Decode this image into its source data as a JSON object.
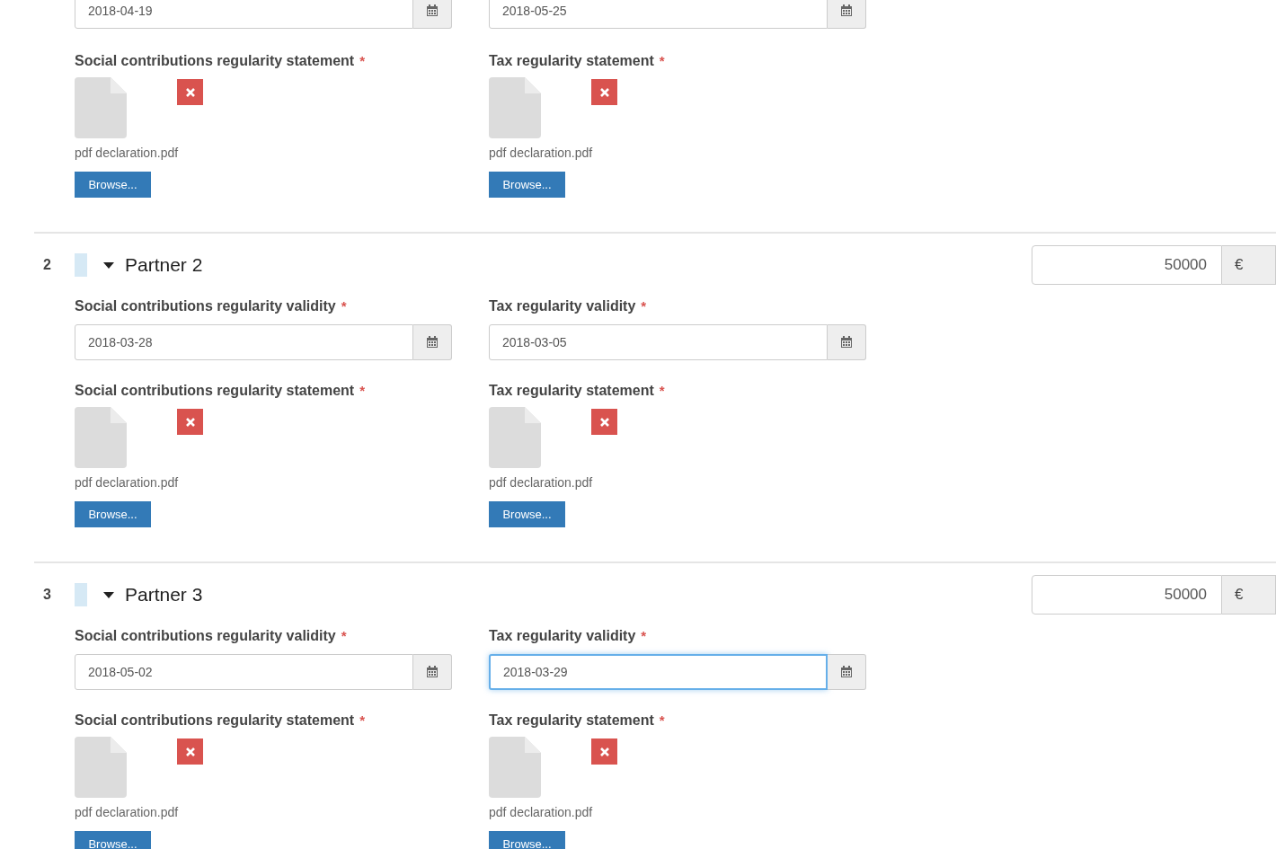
{
  "partial_partner": {
    "dates": [
      {
        "value": "2018-04-19",
        "focused": false
      },
      {
        "value": "2018-05-25",
        "focused": false
      }
    ],
    "statements": [
      {
        "label": "Social contributions regularity statement",
        "required_mark": "*",
        "file": "pdf declaration.pdf",
        "browse": "Browse..."
      },
      {
        "label": "Tax regularity statement",
        "required_mark": "*",
        "file": "pdf declaration.pdf",
        "browse": "Browse..."
      }
    ]
  },
  "partners": [
    {
      "number": "2",
      "name": "Partner 2",
      "expanded": true,
      "amount": "50000",
      "currency": "€",
      "dates": [
        {
          "label": "Social contributions regularity validity",
          "required_mark": "*",
          "value": "2018-03-28",
          "focused": false
        },
        {
          "label": "Tax regularity validity",
          "required_mark": "*",
          "value": "2018-03-05",
          "focused": false
        }
      ],
      "statements": [
        {
          "label": "Social contributions regularity statement",
          "required_mark": "*",
          "file": "pdf declaration.pdf",
          "browse": "Browse..."
        },
        {
          "label": "Tax regularity statement",
          "required_mark": "*",
          "file": "pdf declaration.pdf",
          "browse": "Browse..."
        }
      ]
    },
    {
      "number": "3",
      "name": "Partner 3",
      "expanded": true,
      "amount": "50000",
      "currency": "€",
      "dates": [
        {
          "label": "Social contributions regularity validity",
          "required_mark": "*",
          "value": "2018-05-02",
          "focused": false
        },
        {
          "label": "Tax regularity validity",
          "required_mark": "*",
          "value": "2018-03-29",
          "focused": true
        }
      ],
      "statements": [
        {
          "label": "Social contributions regularity statement",
          "required_mark": "*",
          "file": "pdf declaration.pdf",
          "browse": "Browse..."
        },
        {
          "label": "Tax regularity statement",
          "required_mark": "*",
          "file": "pdf declaration.pdf",
          "browse": "Browse..."
        }
      ]
    }
  ]
}
